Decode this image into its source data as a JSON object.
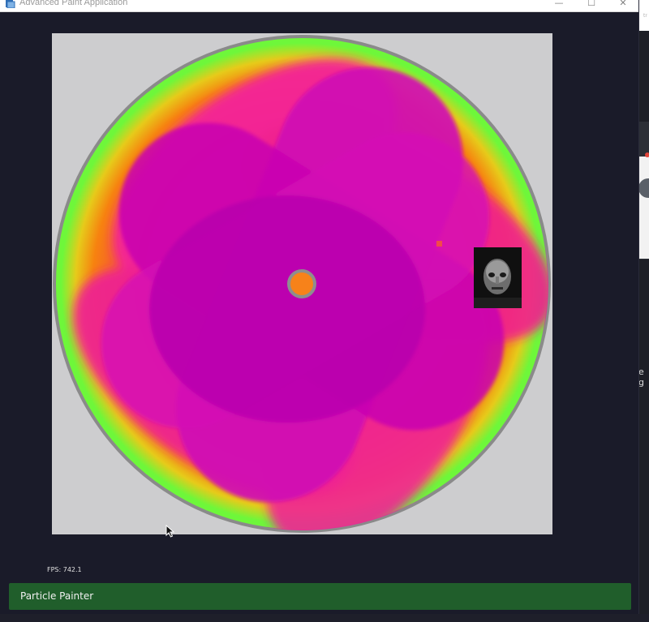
{
  "window": {
    "title": "Advanced Paint Application",
    "minimize_glyph": "—",
    "maximize_glyph": "☐",
    "close_glyph": "✕"
  },
  "canvas": {
    "background_color": "#cdcdcf",
    "palette": {
      "magenta": "#c906b0",
      "pink": "#f21f8a",
      "orange": "#f7820f",
      "yellow": "#e6cb1a",
      "green": "#6ef73a",
      "rim": "#8a8a8a"
    }
  },
  "webcam": {
    "icon": "webcam-preview"
  },
  "fps": {
    "text": "FPS: 742.1"
  },
  "status": {
    "label": "Particle Painter",
    "color": "#205e2b"
  },
  "desktop": {
    "side_text": "e g",
    "tiny_text": "tr"
  }
}
